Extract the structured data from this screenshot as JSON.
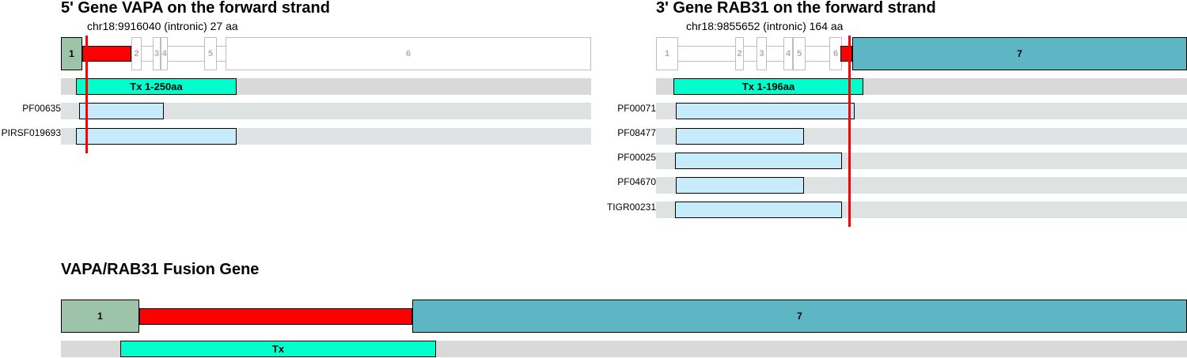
{
  "gene5": {
    "title": "5' Gene VAPA on the forward strand",
    "breakpoint": "chr18:9916040 (intronic) 27 aa",
    "exons": [
      "1",
      "2",
      "3",
      "4",
      "5",
      "6"
    ],
    "transcript": "Tx 1-250aa",
    "domains": [
      "PF00635",
      "PIRSF019693"
    ]
  },
  "gene3": {
    "title": "3' Gene RAB31 on the forward strand",
    "breakpoint": "chr18:9855652 (intronic) 164 aa",
    "exons": [
      "1",
      "2",
      "3",
      "4",
      "5",
      "6",
      "7"
    ],
    "transcript": "Tx 1-196aa",
    "domains": [
      "PF00071",
      "PF08477",
      "PF00025",
      "PF04670",
      "TIGR00231"
    ]
  },
  "fusion": {
    "title": "VAPA/RAB31 Fusion Gene",
    "exons": [
      "1",
      "7"
    ],
    "transcript": "Tx"
  },
  "colors": {
    "gene5_exon": "#9dc4a8",
    "gene3_exon": "#5cb6c4",
    "breakpoint": "#ff0000",
    "transcript": "#00ffcc",
    "domain": "#c6ecfb",
    "track": "#d9d9d9"
  }
}
